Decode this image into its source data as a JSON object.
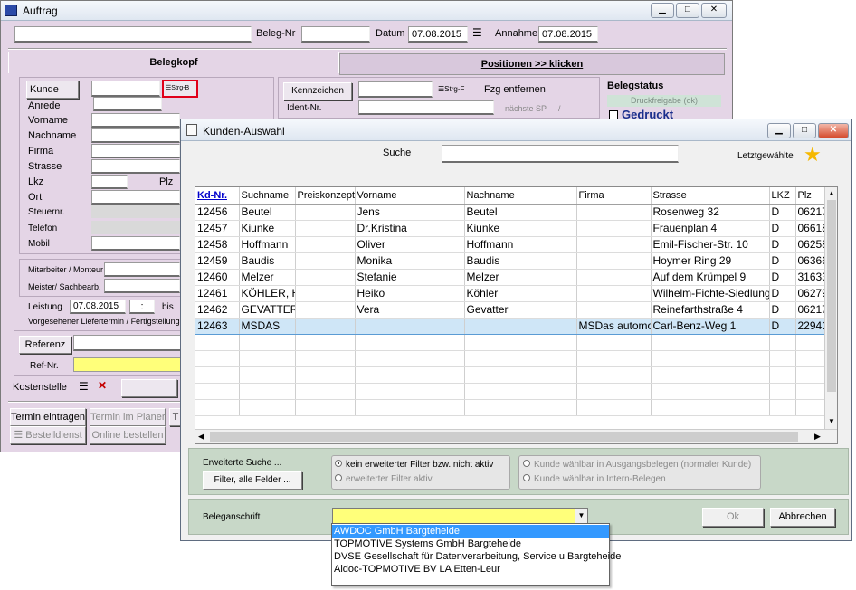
{
  "auftrag": {
    "title": "Auftrag",
    "header": {
      "beleg_nr_label": "Beleg-Nr",
      "datum_label": "Datum",
      "datum_value": "07.08.2015",
      "annahme_label": "Annahme",
      "annahme_value": "07.08.2015"
    },
    "tabs": [
      "Belegkopf",
      "Positionen >> klicken"
    ],
    "left_labels": [
      "Kunde",
      "Anrede",
      "Vorname",
      "Nachname",
      "Firma",
      "Strasse",
      "Lkz",
      "Ort",
      "Steuernr.",
      "Telefon",
      "Mobil"
    ],
    "plz_label": "Plz",
    "strg_b": "Strg-B",
    "kennzeichen_label": "Kennzeichen",
    "strg_f": "Strg-F",
    "fzg_entfernen": "Fzg entfernen",
    "ident_nr_label": "Ident-Nr.",
    "naechste_sp": "nächste SP",
    "slash": "/",
    "belegstatus_label": "Belegstatus",
    "druckfreigabe": "Druckfreigabe (ok)",
    "gedruckt": "Gedruckt",
    "mitarbeiter_label": "Mitarbeiter / Monteur",
    "meister_label": "Meister/ Sachbearb.",
    "leistung_label": "Leistung",
    "leistung_value": "07.08.2015",
    "leistung_time": ":",
    "bis_label": "bis",
    "liefertermin_label": "Vorgesehener Liefertermin / Fertigstellung",
    "referenz_button": "Referenz",
    "ref_nr_label": "Ref-Nr.",
    "kostenstelle_label": "Kostenstelle",
    "buttons": {
      "termin_eintragen": "Termin eintragen",
      "termin_im_planer": "Termin im Planer",
      "t_cut": "T",
      "bestelldienst": "Bestelldienst",
      "online_bestellen": "Online bestellen"
    }
  },
  "kunden": {
    "title": "Kunden-Auswahl",
    "suche_label": "Suche",
    "letzt_label": "Letztgewählte",
    "columns": [
      "Kd-Nr.",
      "Suchname",
      "Preiskonzept",
      "Vorname",
      "Nachname",
      "Firma",
      "Strasse",
      "LKZ",
      "Plz"
    ],
    "rows": [
      [
        "12456",
        "Beutel",
        "",
        "Jens",
        "Beutel",
        "",
        "Rosenweg 32",
        "D",
        "06217"
      ],
      [
        "12457",
        "Kiunke",
        "",
        "Dr.Kristina",
        "Kiunke",
        "",
        "Frauenplan 4",
        "D",
        "06618"
      ],
      [
        "12458",
        "Hoffmann",
        "",
        "Oliver",
        "Hoffmann",
        "",
        "Emil-Fischer-Str. 10",
        "D",
        "06258"
      ],
      [
        "12459",
        "Baudis",
        "",
        "Monika",
        "Baudis",
        "",
        "Hoymer Ring 29",
        "D",
        "06366"
      ],
      [
        "12460",
        "Melzer",
        "",
        "Stefanie",
        "Melzer",
        "",
        "Auf dem Krümpel 9",
        "D",
        "31633"
      ],
      [
        "12461",
        "KÖHLER, H",
        "",
        "Heiko",
        "Köhler",
        "",
        "Wilhelm-Fichte-Siedlung",
        "D",
        "06279"
      ],
      [
        "12462",
        "GEVATTER",
        "",
        "Vera",
        "Gevatter",
        "",
        "Reinefarthstraße 4",
        "D",
        "06217"
      ],
      [
        "12463",
        "MSDAS",
        "",
        "",
        "",
        "MSDas automo",
        "Carl-Benz-Weg 1",
        "D",
        "22941"
      ]
    ],
    "selected_row": 7,
    "erweiterte_label": "Erweiterte Suche ...",
    "filter_button": "Filter, alle Felder ...",
    "radio_kein": "kein erweiterter Filter bzw. nicht aktiv",
    "radio_erweitert": "erweiterter Filter aktiv",
    "radio_ausgang": "Kunde wählbar in Ausgangsbelegen (normaler Kunde)",
    "radio_intern": "Kunde wählbar in Intern-Belegen",
    "beleganschrift_label": "Beleganschrift",
    "ok_button": "Ok",
    "abbrechen_button": "Abbrechen",
    "dropdown": [
      "AWDOC GmbH Bargteheide",
      "TOPMOTIVE Systems GmbH Bargteheide",
      "DVSE Gesellschaft für Datenverarbeitung, Service u Bargteheide",
      "Aldoc-TOPMOTIVE BV LA Etten-Leur"
    ]
  }
}
